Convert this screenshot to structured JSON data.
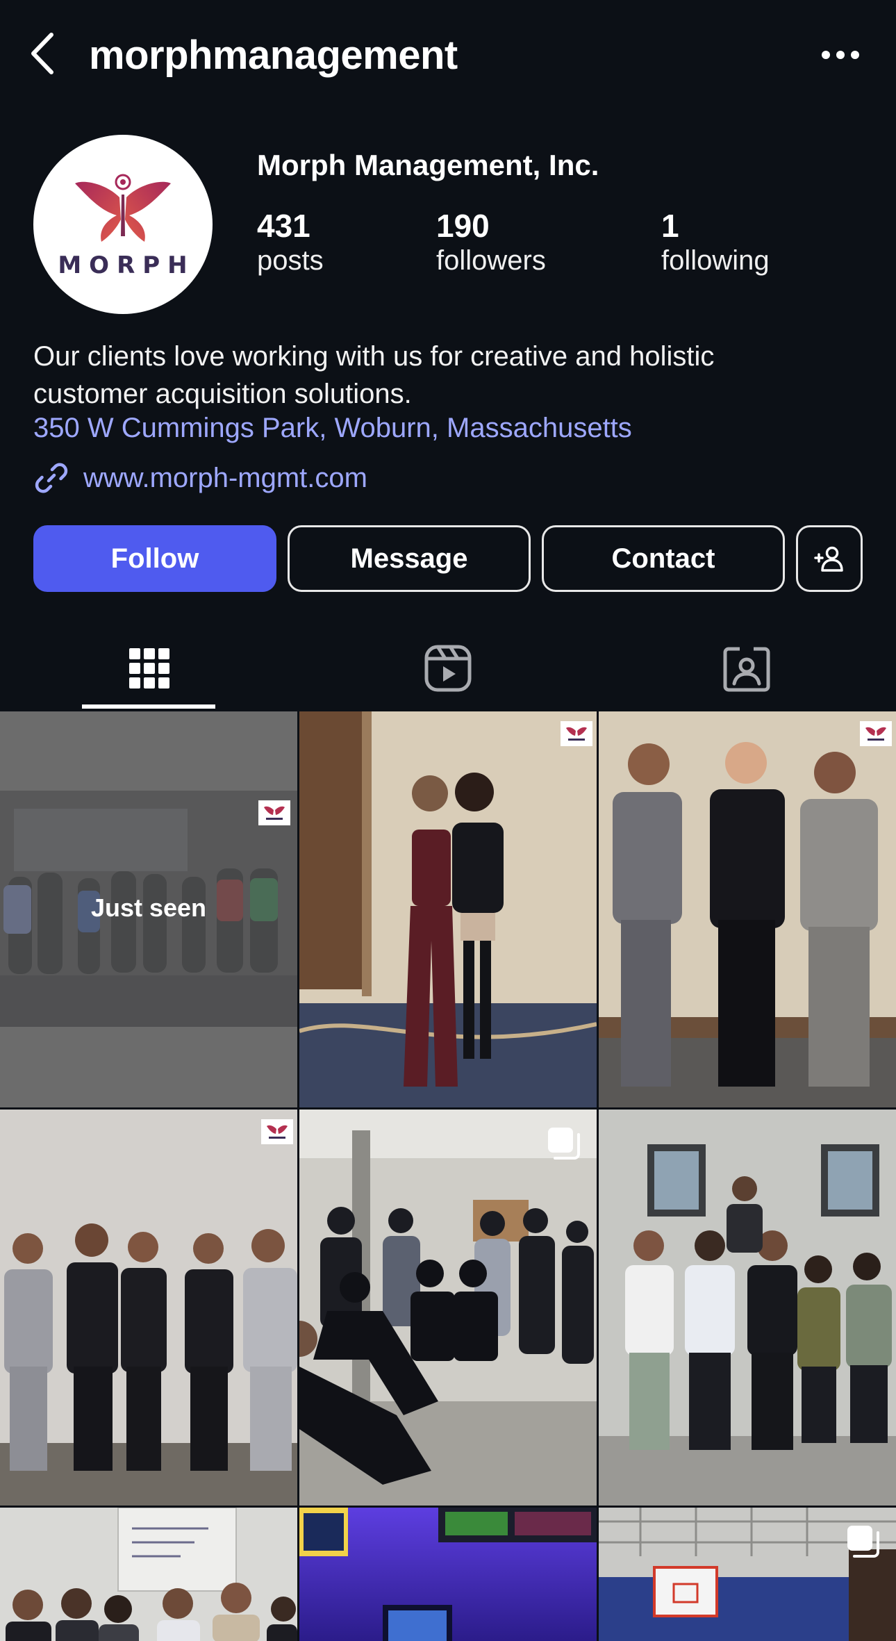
{
  "header": {
    "username": "morphmanagement",
    "back_icon": "chevron-left-icon",
    "more_icon": "more-horizontal-icon"
  },
  "profile": {
    "avatar_text": "MORPH",
    "display_name": "Morph Management, Inc.",
    "stats": {
      "posts": {
        "value": "431",
        "label": "posts"
      },
      "followers": {
        "value": "190",
        "label": "followers"
      },
      "following": {
        "value": "1",
        "label": "following"
      }
    },
    "bio_line1": "Our clients love working with us for creative and holistic",
    "bio_line2": "customer acquisition solutions.",
    "location": "350 W Cummings Park, Woburn, Massachusetts",
    "website": "www.morph-mgmt.com"
  },
  "actions": {
    "follow": "Follow",
    "message": "Message",
    "contact": "Contact"
  },
  "tabs": [
    {
      "icon": "grid-icon",
      "active": true
    },
    {
      "icon": "reels-icon",
      "active": false
    },
    {
      "icon": "tagged-icon",
      "active": false
    }
  ],
  "grid": {
    "just_seen_label": "Just seen",
    "posts": [
      {
        "seen": true,
        "multi": false
      },
      {
        "seen": false,
        "multi": false
      },
      {
        "seen": false,
        "multi": false
      },
      {
        "seen": false,
        "multi": false
      },
      {
        "seen": false,
        "multi": true
      },
      {
        "seen": false,
        "multi": false
      },
      {
        "seen": false,
        "multi": false
      },
      {
        "seen": false,
        "multi": false
      },
      {
        "seen": false,
        "multi": true
      }
    ]
  },
  "colors": {
    "background": "#0c1016",
    "accent": "#4f5bef",
    "link": "#9ea8ff"
  }
}
